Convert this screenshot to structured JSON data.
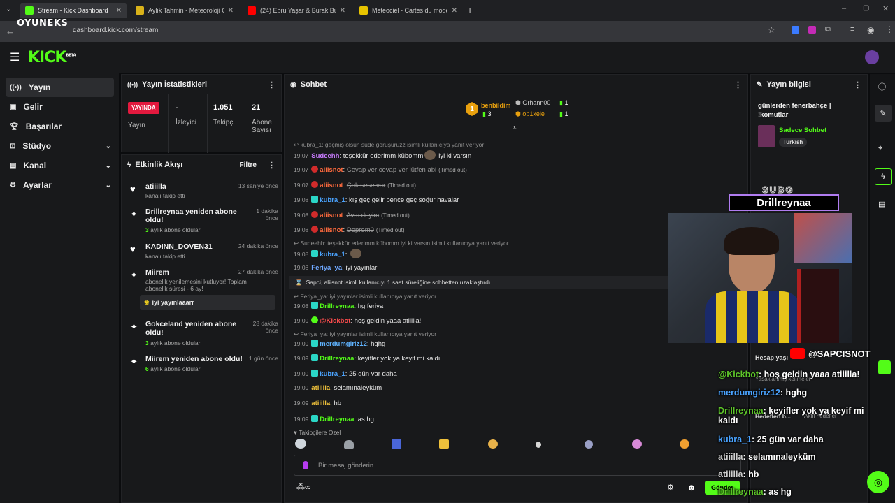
{
  "browser": {
    "tabs": [
      {
        "title": "Stream - Kick Dashboard",
        "favicon_color": "#53fc18",
        "active": true
      },
      {
        "title": "Aylık Tahmin - Meteoroloji Genel",
        "favicon_color": "#d9b21a",
        "active": false
      },
      {
        "title": "(24) Ebru Yaşar & Burak Bul",
        "favicon_color": "#ff0000",
        "active": false
      },
      {
        "title": "Meteociel - Cartes du modèle",
        "favicon_color": "#e8c400",
        "active": false
      }
    ],
    "url": "dashboard.kick.com/stream",
    "watermark": "OYUNEKS"
  },
  "header": {
    "logo": "KICK",
    "logo_sup": "BETA"
  },
  "sidebar": {
    "items": [
      {
        "label": "Yayın",
        "icon": "broadcast-icon",
        "active": true,
        "chevron": false
      },
      {
        "label": "Gelir",
        "icon": "revenue-icon",
        "active": false,
        "chevron": false
      },
      {
        "label": "Başarılar",
        "icon": "trophy-icon",
        "active": false,
        "chevron": false
      },
      {
        "label": "Stüdyo",
        "icon": "studio-icon",
        "active": false,
        "chevron": true
      },
      {
        "label": "Kanal",
        "icon": "channel-icon",
        "active": false,
        "chevron": true
      },
      {
        "label": "Ayarlar",
        "icon": "settings-icon",
        "active": false,
        "chevron": true
      }
    ]
  },
  "stats": {
    "title": "Yayın İstatistikleri",
    "live_badge": "YAYINDA",
    "stream_label": "Yayın",
    "viewers_value": "-",
    "viewers_label": "İzleyici",
    "followers_value": "1.051",
    "followers_label": "Takipçi",
    "subs_value": "21",
    "subs_label": "Abone Sayısı"
  },
  "activity": {
    "title": "Etkinlik Akışı",
    "filter": "Filtre",
    "items": [
      {
        "icon": "heart-icon",
        "title": "atiiilla",
        "sub": "kanalı takip etti",
        "sub_highlight": "",
        "ago": "13 saniye önce"
      },
      {
        "icon": "sparkle-icon",
        "title": "Drillreynaa yeniden abone oldu!",
        "sub": " aylık abone oldular",
        "sub_highlight": "3",
        "ago": "1 dakika önce"
      },
      {
        "icon": "heart-icon",
        "title": "KADINN_DOVEN31",
        "sub": "kanalı takip etti",
        "sub_highlight": "",
        "ago": "24 dakika önce"
      },
      {
        "icon": "sparkle-icon",
        "title": "Miirem",
        "sub": "abonelik yenilemesini kutluyor! Toplam abonelik süresi - 6 ay!",
        "sub_highlight": "",
        "ago": "27 dakika önce",
        "quote": "iyi yayınlaaarr"
      },
      {
        "icon": "sparkle-icon",
        "title": "Gokceland yeniden abone oldu!",
        "sub": " aylık abone oldular",
        "sub_highlight": "3",
        "ago": "28 dakika önce"
      },
      {
        "icon": "sparkle-icon",
        "title": "Miirem yeniden abone oldu!",
        "sub": " aylık abone oldular",
        "sub_highlight": "6",
        "ago": "1 gün önce"
      }
    ]
  },
  "chat": {
    "title": "Sohbet",
    "leaderboard": [
      {
        "rank": "1",
        "name": "benbildim",
        "count": "3"
      },
      {
        "name": "Orhann00",
        "count": "1"
      },
      {
        "name": "op1xele",
        "count": "1"
      }
    ],
    "messages": [
      {
        "reply": "kubra_1: geçmiş olsun sude görüşürüzz isimli kullanıcıya yanıt veriyor"
      },
      {
        "time": "19:07",
        "user": "Sudeehh",
        "color": "#c97cff",
        "text": "teşekkür ederimm kübomm",
        "emote": true,
        "text2": "iyi ki varsın"
      },
      {
        "time": "19:07",
        "user": "aliisnot",
        "color": "#ff6a3d",
        "badge": "rd",
        "text": "Cevap ver cevap ver lütfen abi",
        "strike": true,
        "note": "(Timed out)"
      },
      {
        "time": "19:07",
        "user": "aliisnot",
        "color": "#ff6a3d",
        "badge": "rd",
        "text": "Çok sese var",
        "strike": true,
        "note": "(Timed out)"
      },
      {
        "time": "19:08",
        "user": "kubra_1",
        "color": "#4aa3ff",
        "badge": "sq",
        "text": "kış geç gelir bence geç soğur havalar"
      },
      {
        "time": "19:08",
        "user": "aliisnot",
        "color": "#ff6a3d",
        "badge": "rd",
        "text": "Avm deyim",
        "strike": true,
        "note": "(Timed out)"
      },
      {
        "time": "19:08",
        "user": "aliisnot",
        "color": "#ff6a3d",
        "badge": "rd",
        "text": "Deprem0",
        "strike": true,
        "note": "(Timed out)"
      },
      {
        "reply": "Sudeehh: teşekkür ederimm kübomm iyi ki varsın isimli kullanıcıya yanıt veriyor"
      },
      {
        "time": "19:08",
        "user": "kubra_1",
        "color": "#4aa3ff",
        "badge": "sq",
        "text": "",
        "emote": true
      },
      {
        "time": "19:08",
        "user": "Feriya_ya",
        "color": "#6fa8ff",
        "text": "iyi yayınlar"
      },
      {
        "system": "Sapci, aliisnot isimli kullanıcıyı 1 saat süreliğine sohbetten uzaklaştırdı"
      },
      {
        "reply": "Feriya_ya: iyi yayınlar isimli kullanıcıya yanıt veriyor"
      },
      {
        "time": "19:08",
        "user": "Drillreynaa",
        "color": "#53fc18",
        "badge": "sq",
        "text": "hg feriya"
      },
      {
        "time": "19:09",
        "user": "@Kickbot",
        "color": "#ff4d4d",
        "badge": "gr",
        "text": "hoş geldin yaaa atiiilla!"
      },
      {
        "reply": "Feriya_ya: iyi yayınlar isimli kullanıcıya yanıt veriyor"
      },
      {
        "time": "19:09",
        "user": "merdumgiriz12",
        "color": "#5fb3ff",
        "badge": "sq",
        "text": "hghg"
      },
      {
        "time": "19:09",
        "user": "Drillreynaa",
        "color": "#53fc18",
        "badge": "sq",
        "text": "keyifler yok ya keyif mi kaldı"
      },
      {
        "time": "19:09",
        "user": "kubra_1",
        "color": "#4aa3ff",
        "badge": "sq",
        "text": "25 gün var daha"
      },
      {
        "time": "19:09",
        "user": "atiiilla",
        "color": "#f0c23b",
        "text": "selamınaleyküm"
      },
      {
        "time": "19:09",
        "user": "atiiilla",
        "color": "#f0c23b",
        "text": "hb"
      },
      {
        "time": "19:09",
        "user": "Drillreynaa",
        "color": "#53fc18",
        "badge": "sq",
        "text": "as hg"
      }
    ],
    "followers_only": "Takipçilere Özel",
    "placeholder": "Bir mesaj gönderin",
    "send": "Gönder"
  },
  "stream_info": {
    "title": "Yayın bilgisi",
    "stream_title": "günlerden fenerbahçe | !komutlar",
    "category": "Sadece Sohbet",
    "tag": "Turkish",
    "account_health": "Hesap yaşı",
    "safety_settings": "Yasaklanmış kelimeler",
    "goals": "Hedefleri b...",
    "active_goal": "Aktif hedefler"
  },
  "overlay": {
    "sub_label": "SUBG",
    "sub_name": "Drillreynaa",
    "social": "@SAPCISNOT",
    "lines": [
      {
        "user": "@Kickbot",
        "text": ": hoş geldin yaaa atiiilla!",
        "cls": "u"
      },
      {
        "user": "merdumgiriz12",
        "text": ": hghg",
        "cls": "u2"
      },
      {
        "user": "Drillreynaa",
        "text": ": keyifler yok ya keyif mi kaldı",
        "cls": "u"
      },
      {
        "user": "kubra_1",
        "text": ": 25 gün var daha",
        "cls": "u2"
      },
      {
        "user": "atiiilla",
        "text": ": selamınaleyküm",
        "cls": "u3"
      },
      {
        "user": "atiiilla",
        "text": ": hb",
        "cls": "u3"
      },
      {
        "user": "Drillreynaa",
        "text": ": as hg",
        "cls": "u"
      }
    ]
  }
}
